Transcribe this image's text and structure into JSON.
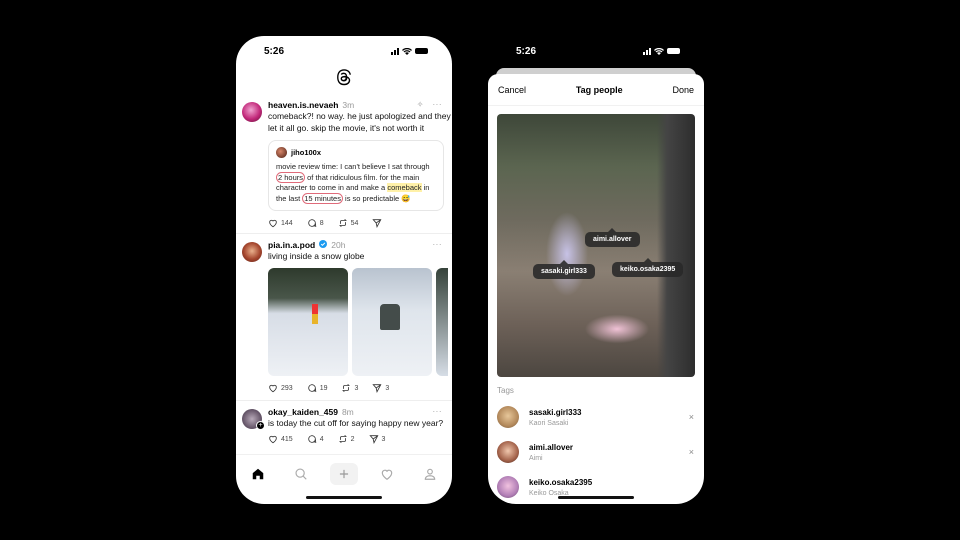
{
  "left_phone": {
    "status": {
      "time": "5:26"
    },
    "app_logo": "threads-logo",
    "posts": [
      {
        "username": "heaven.is.nevaeh",
        "time": "3m",
        "more": "···",
        "text": "comeback?! no way. he just apologized and they let it all go. skip the movie, it's not worth it",
        "quote": {
          "username": "jiho100x",
          "text_parts": [
            "movie review time: I can't believe I sat through ",
            "2 hours",
            " of that ridiculous film. for the main character to come in and make a ",
            "comeback",
            " in the last ",
            "15 minutes",
            " is so predictable 😅"
          ]
        },
        "likes": "144",
        "replies": "8",
        "reposts": "54"
      },
      {
        "username": "pia.in.a.pod",
        "verified": true,
        "time": "20h",
        "more": "···",
        "text": "living inside a snow globe",
        "images": [
          "skier-on-slope",
          "snow-cannon",
          "forest-slope"
        ],
        "likes": "293",
        "replies": "19",
        "reposts": "3",
        "shares": "3"
      },
      {
        "username": "okay_kaiden_459",
        "time": "8m",
        "more": "···",
        "text": "is today the cut off for saying happy new year?",
        "likes": "415",
        "replies": "4",
        "reposts": "2",
        "shares": "3"
      }
    ],
    "tabbar": [
      "home",
      "search",
      "create",
      "activity",
      "profile"
    ]
  },
  "right_phone": {
    "status": {
      "time": "5:26"
    },
    "header": {
      "cancel": "Cancel",
      "title": "Tag people",
      "done": "Done"
    },
    "photo_tags": [
      "aimi.allover",
      "sasaki.girl333",
      "keiko.osaka2395"
    ],
    "tags_label": "Tags",
    "tags": [
      {
        "username": "sasaki.girl333",
        "name": "Kaori Sasaki",
        "remove": "×"
      },
      {
        "username": "aimi.allover",
        "name": "Aimi",
        "remove": "×"
      },
      {
        "username": "keiko.osaka2395",
        "name": "Keiko Osaka",
        "remove": ""
      }
    ]
  },
  "colors": {
    "verified": "#1d9bf0",
    "highlight": "#fff1a8",
    "annotation": "#e06b7a"
  }
}
